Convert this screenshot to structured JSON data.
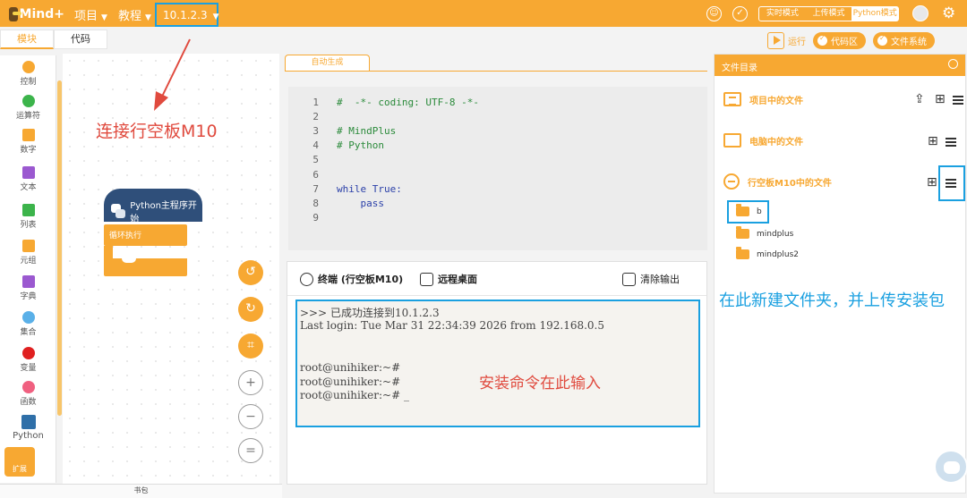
{
  "topbar": {
    "logo": "Mind+",
    "menu_project": "项目",
    "menu_tutorial": "教程",
    "device_ip": "10.1.2.3",
    "modes": [
      "实时模式",
      "上传模式",
      "Python模式"
    ],
    "active_mode": "Python模式"
  },
  "tabs": {
    "blocks": "模块",
    "code": "代码"
  },
  "runbar": {
    "run": "运行",
    "code_area": "代码区",
    "file_system": "文件系统"
  },
  "categories": [
    {
      "label": "控制",
      "color": "#f7a832"
    },
    {
      "label": "运算符",
      "color": "#3cb44b"
    },
    {
      "label": "数字",
      "color": "#f7a832"
    },
    {
      "label": "文本",
      "color": "#9b59d0"
    },
    {
      "label": "列表",
      "color": "#3cb44b"
    },
    {
      "label": "元组",
      "color": "#f7a832"
    },
    {
      "label": "字典",
      "color": "#9b59d0"
    },
    {
      "label": "集合",
      "color": "#5ab0e8"
    },
    {
      "label": "变量",
      "color": "#e02020"
    },
    {
      "label": "函数",
      "color": "#f06080"
    },
    {
      "label": "Python",
      "color": "#2f6fa8"
    }
  ],
  "extension_label": "扩展",
  "workspace": {
    "annotation": "连接行空板M10",
    "hat_block": "Python主程序开始",
    "loop_block": "循环执行"
  },
  "bookbag": "书包",
  "editor": {
    "tab": "自动生成",
    "lines": [
      {
        "n": "1",
        "text": "#  -*- coding: UTF-8 -*-",
        "kind": "comment"
      },
      {
        "n": "2",
        "text": "",
        "kind": "plain"
      },
      {
        "n": "3",
        "text": "# MindPlus",
        "kind": "comment"
      },
      {
        "n": "4",
        "text": "# Python",
        "kind": "comment"
      },
      {
        "n": "5",
        "text": "",
        "kind": "plain"
      },
      {
        "n": "6",
        "text": "",
        "kind": "plain"
      },
      {
        "n": "7",
        "text": "while True:",
        "kind": "keyword"
      },
      {
        "n": "8",
        "text": "    pass",
        "kind": "keyword"
      },
      {
        "n": "9",
        "text": "",
        "kind": "plain"
      }
    ]
  },
  "terminal": {
    "tab_terminal": "终端 (行空板M10)",
    "tab_remote": "远程桌面",
    "clear": "清除输出",
    "lines": [
      ">>> 已成功连接到10.1.2.3",
      "Last login: Tue Mar 31 22:34:39 2026 from 192.168.0.5",
      "",
      "",
      "root@unihiker:~#",
      "root@unihiker:~#",
      "root@unihiker:~# _"
    ],
    "annotation": "安装命令在此输入"
  },
  "files": {
    "header": "文件目录",
    "section_project": "项目中的文件",
    "section_computer": "电脑中的文件",
    "section_board": "行空板M10中的文件",
    "folders": [
      "b",
      "mindplus",
      "mindplus2"
    ],
    "annotation": "在此新建文件夹，并上传安装包"
  }
}
